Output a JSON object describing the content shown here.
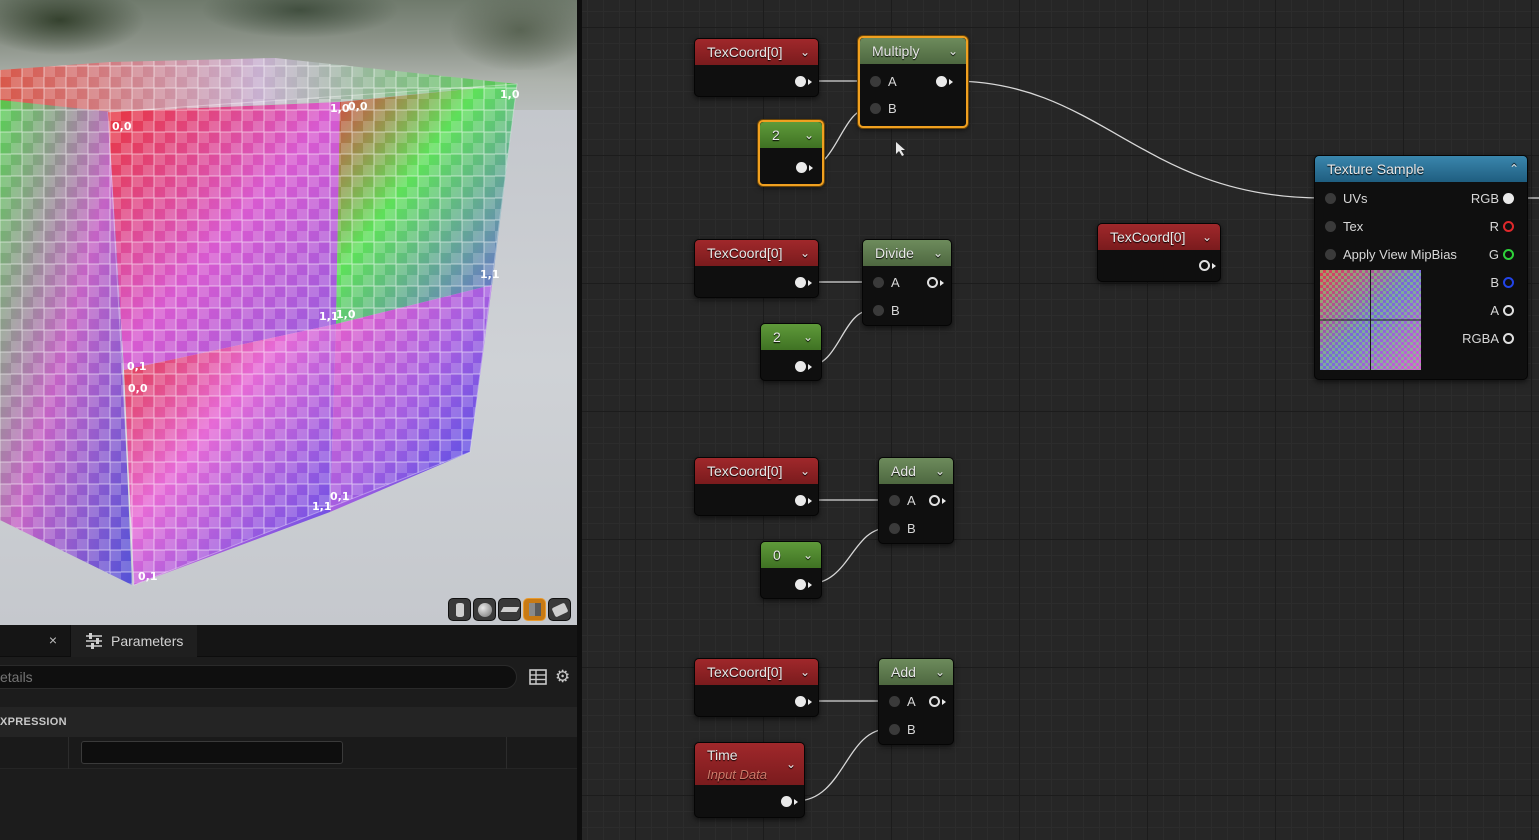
{
  "viewport": {
    "cube_labels": [
      "0,0",
      "1,0",
      "0,0",
      "1,0",
      "0,1",
      "1,1",
      "0,0",
      "1,1",
      "0,1",
      "1,0",
      "1,1",
      "0,1"
    ],
    "toolbar_icons": [
      "cylinder-icon",
      "sphere-icon",
      "plane-icon",
      "cube-icon",
      "custom-mesh-icon"
    ]
  },
  "details": {
    "tabs": {
      "close_glyph": "×",
      "parameters_label": "Parameters"
    },
    "search": {
      "placeholder": "etails"
    },
    "section_title": "XPRESSION"
  },
  "graph": {
    "nodes": {
      "texcoord1": {
        "title": "TexCoord[0]"
      },
      "multiply": {
        "title": "Multiply",
        "pin_a": "A",
        "pin_b": "B"
      },
      "const2a": {
        "title": "2"
      },
      "texture_sample": {
        "title": "Texture Sample",
        "inputs": [
          "UVs",
          "Tex",
          "Apply View MipBias"
        ],
        "outputs": [
          "RGB",
          "R",
          "G",
          "B",
          "A",
          "RGBA"
        ]
      },
      "texcoord_floating": {
        "title": "TexCoord[0]"
      },
      "texcoord2": {
        "title": "TexCoord[0]"
      },
      "divide": {
        "title": "Divide",
        "pin_a": "A",
        "pin_b": "B"
      },
      "const2b": {
        "title": "2"
      },
      "texcoord3": {
        "title": "TexCoord[0]"
      },
      "add1": {
        "title": "Add",
        "pin_a": "A",
        "pin_b": "B"
      },
      "const0": {
        "title": "0"
      },
      "texcoord4": {
        "title": "TexCoord[0]"
      },
      "add2": {
        "title": "Add",
        "pin_a": "A",
        "pin_b": "B"
      },
      "time": {
        "title": "Time",
        "subtitle": "Input Data"
      }
    },
    "pin_colors": {
      "R": "#e0282b",
      "G": "#2ed23a",
      "B": "#2244e8",
      "default": "#e0e0e0"
    }
  }
}
